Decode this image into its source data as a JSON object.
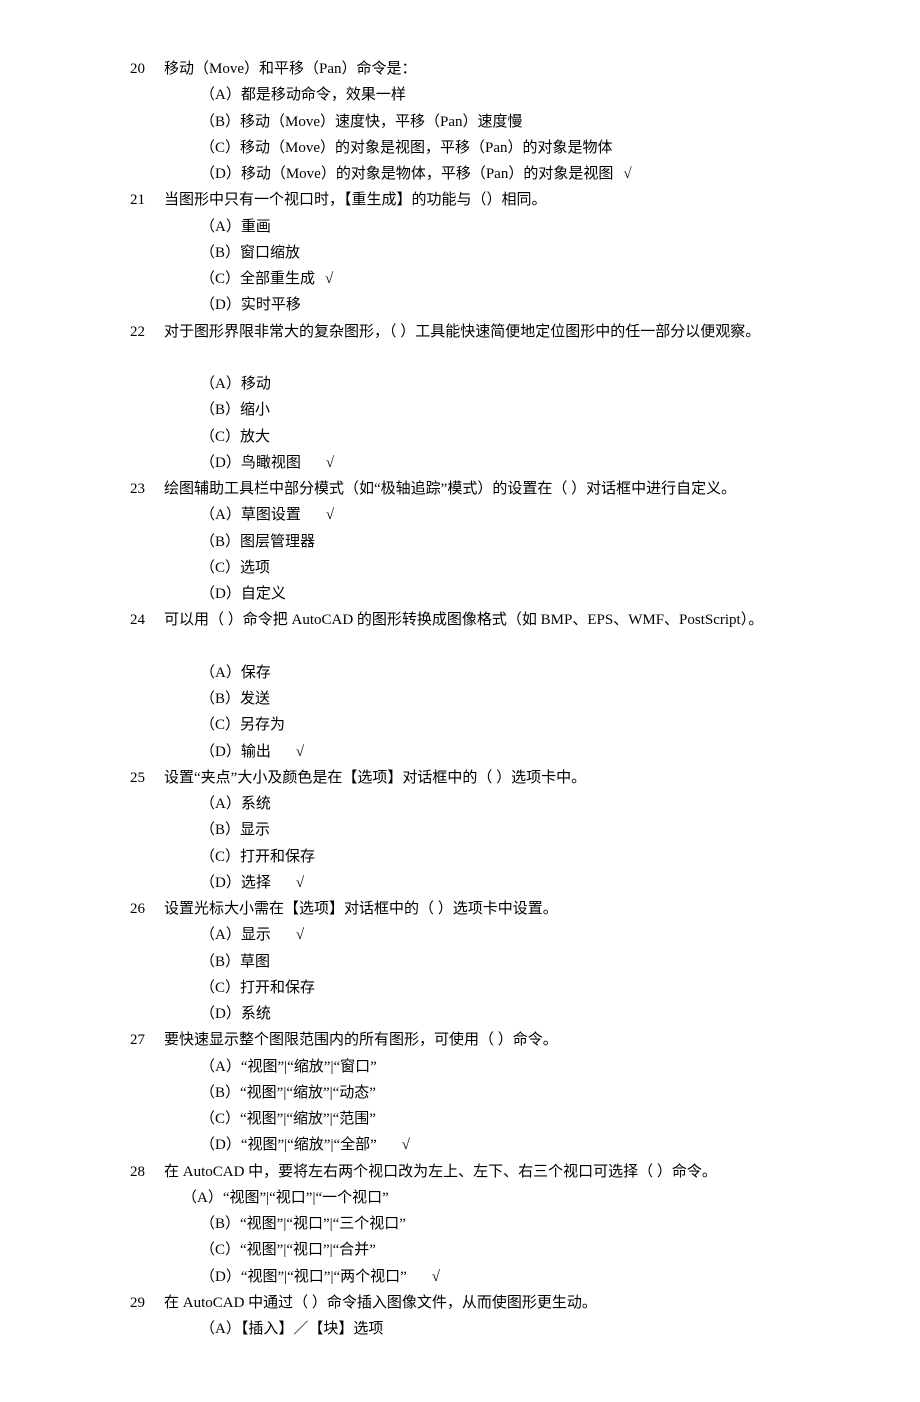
{
  "questions": [
    {
      "num": "20",
      "text": "移动（Move）和平移（Pan）命令是：",
      "options": [
        {
          "label": "（A）都是移动命令，效果一样",
          "correct": false
        },
        {
          "label": "（B）移动（Move）速度快，平移（Pan）速度慢",
          "correct": false
        },
        {
          "label": "（C）移动（Move）的对象是视图，平移（Pan）的对象是物体",
          "correct": false
        },
        {
          "label": "（D）移动（Move）的对象是物体，平移（Pan）的对象是视图",
          "correct": true
        }
      ],
      "indent": "normal"
    },
    {
      "num": "21",
      "text": "当图形中只有一个视口时，【重生成】的功能与（）相同。",
      "options": [
        {
          "label": "（A）重画",
          "correct": false
        },
        {
          "label": "（B）窗口缩放",
          "correct": false
        },
        {
          "label": "（C）全部重生成",
          "correct": true
        },
        {
          "label": "（D）实时平移",
          "correct": false
        }
      ],
      "indent": "normal"
    },
    {
      "num": "22",
      "text": "对于图形界限非常大的复杂图形，（ ）工具能快速简便地定位图形中的任一部分以便观察。",
      "blank_after": true,
      "options": [
        {
          "label": "（A）移动",
          "correct": false
        },
        {
          "label": "（B）缩小",
          "correct": false
        },
        {
          "label": "（C）放大",
          "correct": false
        },
        {
          "label": "（D）鸟瞰视图　",
          "correct": true
        }
      ],
      "indent": "normal"
    },
    {
      "num": "23",
      "text": "绘图辅助工具栏中部分模式（如“极轴追踪”模式）的设置在（ ）对话框中进行自定义。",
      "options": [
        {
          "label": "（A）草图设置　",
          "correct": true
        },
        {
          "label": "（B）图层管理器",
          "correct": false
        },
        {
          "label": "（C）选项",
          "correct": false
        },
        {
          "label": "（D）自定义",
          "correct": false
        }
      ],
      "indent": "normal"
    },
    {
      "num": "24",
      "text": "可以用（ ）命令把 AutoCAD 的图形转换成图像格式（如 BMP、EPS、WMF、PostScript）。",
      "blank_after": true,
      "options": [
        {
          "label": "（A）保存",
          "correct": false
        },
        {
          "label": "（B）发送",
          "correct": false
        },
        {
          "label": "（C）另存为",
          "correct": false
        },
        {
          "label": "（D）输出　",
          "correct": true
        }
      ],
      "indent": "normal"
    },
    {
      "num": "25",
      "text": "设置“夹点”大小及颜色是在【选项】对话框中的（ ）选项卡中。",
      "options": [
        {
          "label": "（A）系统",
          "correct": false
        },
        {
          "label": "（B）显示",
          "correct": false
        },
        {
          "label": "（C）打开和保存",
          "correct": false
        },
        {
          "label": "（D）选择　",
          "correct": true
        }
      ],
      "indent": "normal"
    },
    {
      "num": "26",
      "text": "设置光标大小需在【选项】对话框中的（ ）选项卡中设置。",
      "options": [
        {
          "label": "（A）显示　",
          "correct": true
        },
        {
          "label": "（B）草图",
          "correct": false
        },
        {
          "label": "（C）打开和保存",
          "correct": false
        },
        {
          "label": "（D）系统",
          "correct": false
        }
      ],
      "indent": "normal"
    },
    {
      "num": "27",
      "text": "要快速显示整个图限范围内的所有图形，可使用（ ）命令。",
      "options": [
        {
          "label": "（A）“视图”|“缩放”|“窗口”",
          "correct": false
        },
        {
          "label": "（B）“视图”|“缩放”|“动态”",
          "correct": false
        },
        {
          "label": "（C）“视图”|“缩放”|“范围”",
          "correct": false
        },
        {
          "label": "（D）“视图”|“缩放”|“全部”　",
          "correct": true
        }
      ],
      "indent": "normal"
    },
    {
      "num": "28",
      "text": "在 AutoCAD 中，要将左右两个视口改为左上、左下、右三个视口可选择（ ）命令。",
      "first_option": "（A）“视图”|“视口”|“一个视口”",
      "options": [
        {
          "label": "（B）“视图”|“视口”|“三个视口”",
          "correct": false
        },
        {
          "label": "（C）“视图”|“视口”|“合并”",
          "correct": false
        },
        {
          "label": "（D）“视图”|“视口”|“两个视口”　",
          "correct": true
        }
      ],
      "indent": "normal"
    },
    {
      "num": "29",
      "text": "在 AutoCAD 中通过（ ）命令插入图像文件，从而使图形更生动。",
      "options": [
        {
          "label": "（A）【插入】／【块】选项",
          "correct": false
        }
      ],
      "indent": "normal"
    }
  ],
  "check_mark": "√"
}
